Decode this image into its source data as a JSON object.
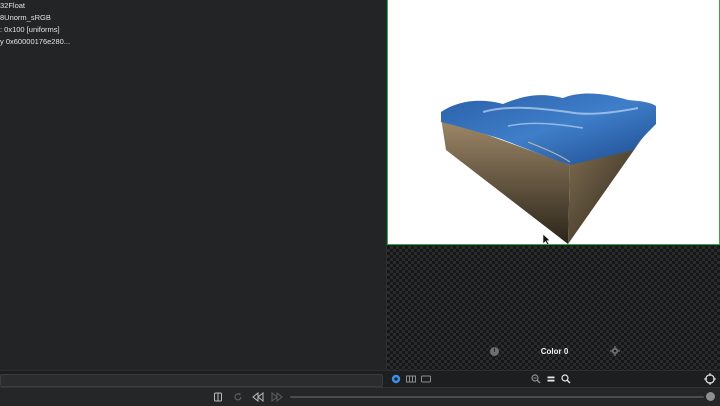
{
  "resources": [
    {
      "text": "32Float"
    },
    {
      "text": "8Unorm_sRGB"
    },
    {
      "text": ": 0x100 [uniforms]"
    },
    {
      "text": "y 0x60000176e280..."
    }
  ],
  "attachment": {
    "label": "Color 0"
  },
  "icons": {
    "info": "info-icon",
    "settings": "gear-icon",
    "target": "crosshair-icon"
  },
  "colors": {
    "viewport_border": "#2faa49",
    "accent": "#3a8ee6",
    "background": "#1f2122"
  }
}
